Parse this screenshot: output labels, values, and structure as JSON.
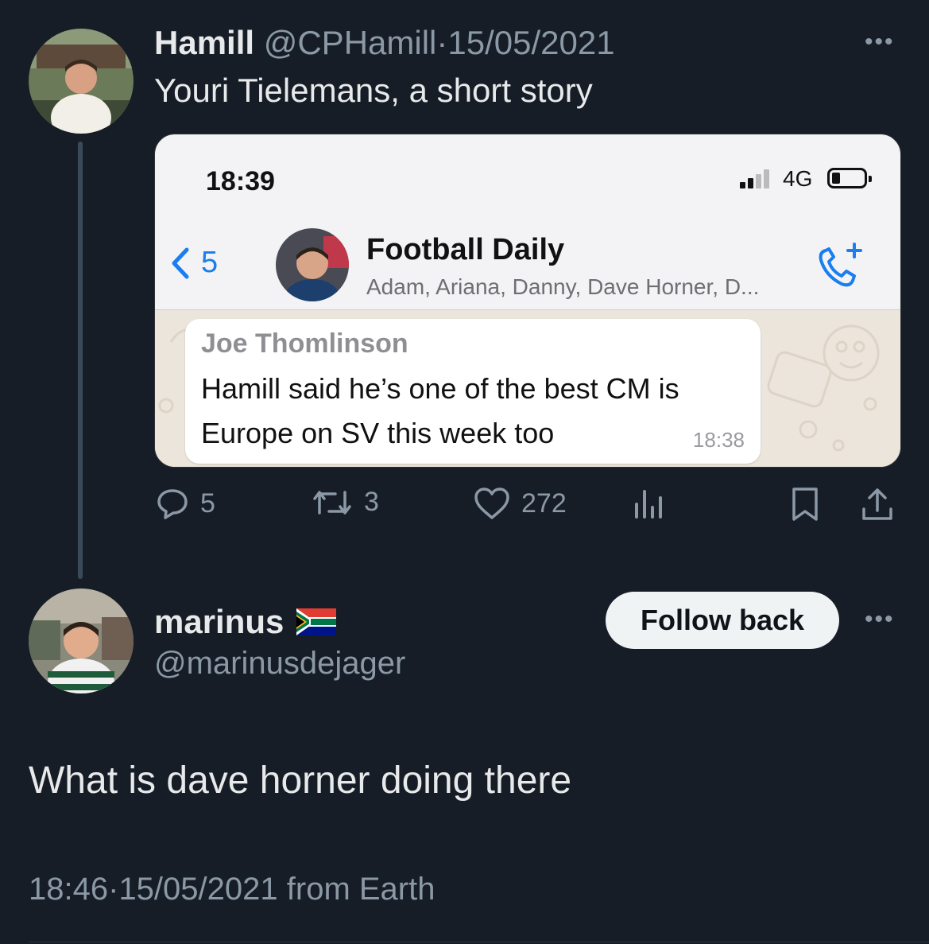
{
  "tweet": {
    "author_name": "Hamill",
    "author_handle": "@CPHamill",
    "dot": "·",
    "date": "15/05/2021",
    "text": "Youri Tielemans, a short story",
    "more": "•••",
    "stats": {
      "replies": "5",
      "retweets": "3",
      "likes": "272"
    }
  },
  "screenshot": {
    "time": "18:39",
    "network": "4G",
    "back_count": "5",
    "group_name": "Football Daily",
    "group_members": "Adam, Ariana, Danny, Dave Horner, D...",
    "message": {
      "sender": "Joe Thomlinson",
      "text": "Hamill said he’s one of the best CM is Europe on SV this week too",
      "time": "18:38"
    }
  },
  "reply": {
    "author_name": "marinus",
    "author_handle": "@marinusdejager",
    "follow_label": "Follow back",
    "more": "•••",
    "text": "What is dave horner doing there",
    "time": "18:46",
    "dot": "·",
    "date": "15/05/2021",
    "source": "from Earth"
  },
  "colors": {
    "background": "#161d26",
    "muted": "#8b98a5",
    "link_blue": "#1a7ef0"
  }
}
